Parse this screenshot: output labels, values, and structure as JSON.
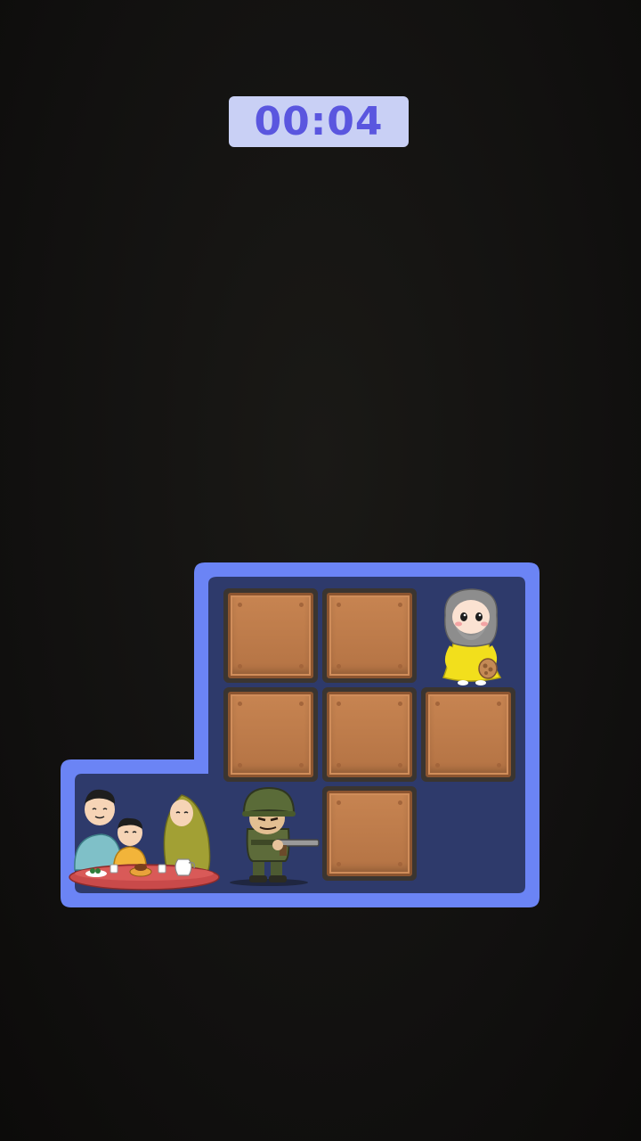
{
  "hud": {
    "timer": "00:04"
  },
  "board": {
    "cells": [
      {
        "row": 0,
        "col": 0,
        "content": "crate"
      },
      {
        "row": 0,
        "col": 1,
        "content": "crate"
      },
      {
        "row": 0,
        "col": 2,
        "content": "grandmother"
      },
      {
        "row": 1,
        "col": 0,
        "content": "crate"
      },
      {
        "row": 1,
        "col": 1,
        "content": "crate"
      },
      {
        "row": 1,
        "col": 2,
        "content": "crate"
      },
      {
        "row": 2,
        "col": -2,
        "content": "family-dinner"
      },
      {
        "row": 2,
        "col": 0,
        "content": "soldier"
      },
      {
        "row": 2,
        "col": 1,
        "content": "crate"
      },
      {
        "row": 2,
        "col": 2,
        "content": "empty"
      }
    ]
  },
  "colors": {
    "frame": "#6b84f5",
    "board_bg": "#2e3a6b",
    "timer_bg": "#c9d0f5",
    "timer_text": "#5a56df",
    "crate": "#c07c4b"
  }
}
